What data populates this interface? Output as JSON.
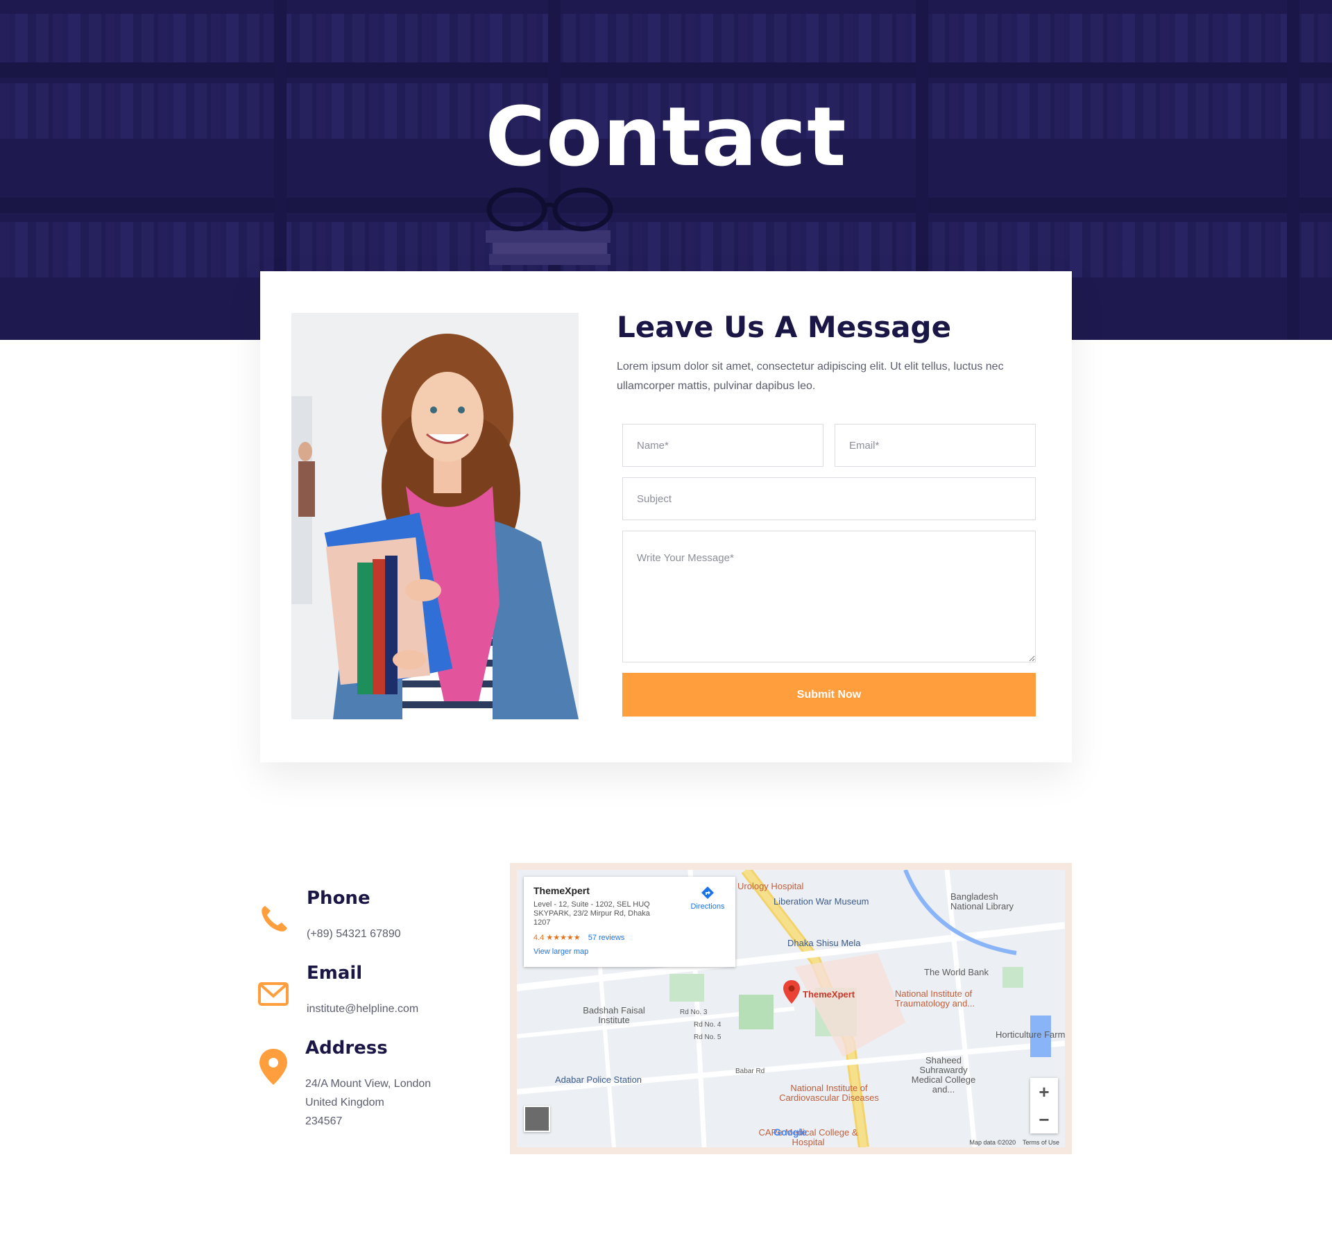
{
  "hero": {
    "title": "Contact"
  },
  "form": {
    "heading": "Leave Us A Message",
    "lead": "Lorem ipsum dolor sit amet, consectetur adipiscing elit. Ut elit tellus, luctus nec ullamcorper mattis, pulvinar dapibus leo.",
    "name_placeholder": "Name*",
    "email_placeholder": "Email*",
    "subject_placeholder": "Subject",
    "message_placeholder": "Write Your Message*",
    "submit_label": "Submit Now"
  },
  "contact": {
    "phone": {
      "title": "Phone",
      "value": "(+89) 54321 67890",
      "icon": "phone-icon"
    },
    "email": {
      "title": "Email",
      "value": "institute@helpline.com",
      "icon": "envelope-icon"
    },
    "address": {
      "title": "Address",
      "lines": [
        "24/A Mount View, London",
        "United Kingdom",
        "234567"
      ],
      "icon": "location-pin-icon"
    }
  },
  "map": {
    "place_name": "ThemeXpert",
    "place_address": "Level - 12, Suite - 1202, SEL HUQ SKYPARK, 23/2 Mirpur Rd, Dhaka 1207",
    "rating": "4.4 ★★★★★",
    "reviews": "57 reviews",
    "larger_map": "View larger map",
    "directions": "Directions",
    "marker_label": "ThemeXpert",
    "labels": {
      "urology": "Urology Hospital",
      "liberation": "Liberation War Museum",
      "library": "Bangladesh National Library",
      "shisu": "Dhaka Shisu Mela",
      "worldbank": "The World Bank",
      "traumatology": "National Institute of Traumatology and...",
      "badshah": "Badshah Faisal Institute",
      "horticulture": "Horticulture Farm",
      "suhrawardy": "Shaheed Suhrawardy Medical College and...",
      "adabar": "Adabar Police Station",
      "cardio": "National Institute of Cardiovascular Diseases",
      "care": "CARe Medical College & Hospital",
      "rd3": "Rd No. 3",
      "rd4": "Rd No. 4",
      "rd5": "Rd No. 5",
      "babar": "Babar Rd"
    },
    "zoom_in": "+",
    "zoom_out": "−",
    "google": "Google",
    "map_data": "Map data ©2020",
    "terms": "Terms of Use"
  },
  "colors": {
    "accent": "#ff9e3d",
    "navy": "#1a1747",
    "hero_bg": "#1e1b4b"
  }
}
